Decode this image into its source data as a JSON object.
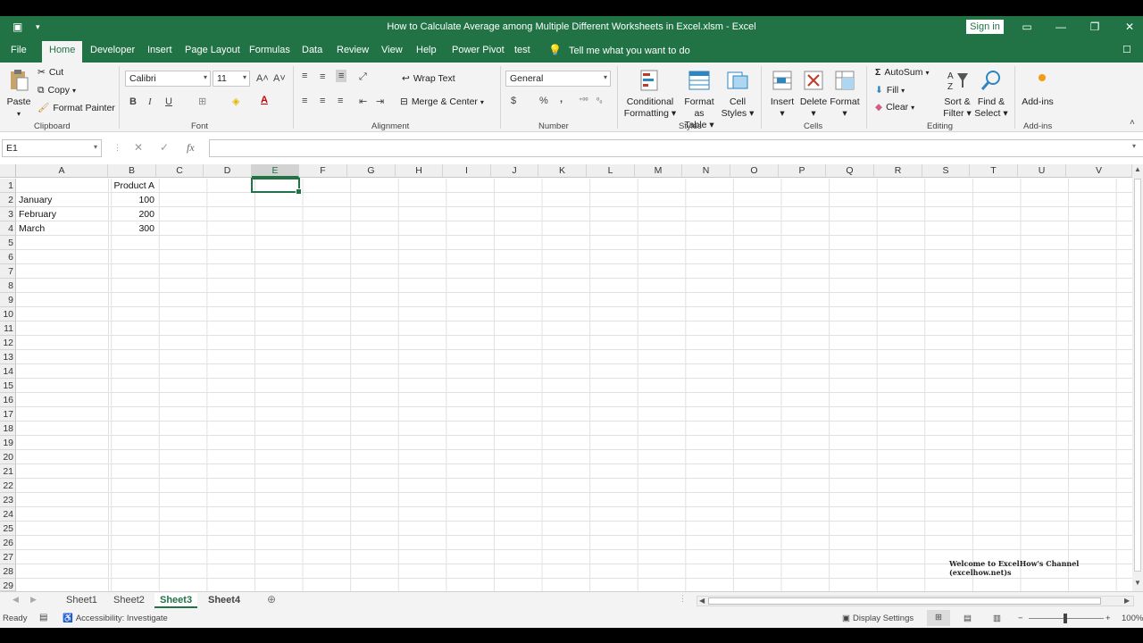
{
  "window": {
    "title": "How to Calculate Average among Multiple Different Worksheets in Excel.xlsm  -  Excel",
    "signin": "Sign in"
  },
  "menu": {
    "tabs": [
      "File",
      "Home",
      "Developer",
      "Insert",
      "Page Layout",
      "Formulas",
      "Data",
      "Review",
      "View",
      "Help",
      "Power Pivot",
      "test"
    ],
    "tell": "Tell me what you want to do"
  },
  "ribbon": {
    "clipboard": {
      "paste": "Paste",
      "cut": "Cut",
      "copy": "Copy",
      "format_painter": "Format Painter",
      "label": "Clipboard"
    },
    "font": {
      "name": "Calibri",
      "size": "11",
      "bold": "B",
      "italic": "I",
      "underline": "U",
      "label": "Font"
    },
    "alignment": {
      "wrap": "Wrap Text",
      "merge": "Merge & Center",
      "label": "Alignment"
    },
    "number": {
      "format": "General",
      "currency": "$",
      "percent": "%",
      "comma": ",",
      "label": "Number"
    },
    "styles": {
      "conditional": [
        "Conditional",
        "Formatting"
      ],
      "format_table": [
        "Format as",
        "Table"
      ],
      "cell_styles": [
        "Cell",
        "Styles"
      ],
      "label": "Styles"
    },
    "cells": {
      "insert": "Insert",
      "delete": "Delete",
      "format": "Format",
      "label": "Cells"
    },
    "editing": {
      "autosum": "AutoSum",
      "fill": "Fill",
      "clear": "Clear",
      "sort": [
        "Sort &",
        "Filter"
      ],
      "find": [
        "Find &",
        "Select"
      ],
      "label": "Editing"
    },
    "addins": {
      "addins": "Add-ins",
      "label": "Add-ins"
    }
  },
  "formula_bar": {
    "name_box": "E1",
    "fx": "fx",
    "value": ""
  },
  "grid": {
    "columns": [
      "A",
      "B",
      "C",
      "D",
      "E",
      "F",
      "G",
      "H",
      "I",
      "J",
      "K",
      "L",
      "M",
      "N",
      "O",
      "P",
      "Q",
      "R",
      "S",
      "T",
      "U",
      "V"
    ],
    "selected_column": "E",
    "rows": [
      "1",
      "2",
      "3",
      "4",
      "5",
      "6",
      "7",
      "8",
      "9",
      "10",
      "11",
      "12",
      "13",
      "14",
      "15",
      "16",
      "17",
      "18",
      "19",
      "20",
      "21",
      "22",
      "23",
      "24",
      "25",
      "26",
      "27",
      "28",
      "29"
    ],
    "data": {
      "B1": "Product A",
      "A2": "January",
      "B2": "100",
      "A3": "February",
      "B3": "200",
      "A4": "March",
      "B4": "300"
    },
    "watermark": "Welcome to ExcelHow's  Channel (excelhow.net)s"
  },
  "sheets": {
    "tabs": [
      "Sheet1",
      "Sheet2",
      "Sheet3",
      "Sheet4"
    ],
    "active": "Sheet3"
  },
  "status": {
    "ready": "Ready",
    "accessibility": "Accessibility: Investigate",
    "display": "Display Settings",
    "zoom": "100%"
  },
  "colors": {
    "excel_green": "#217346",
    "ribbon_bg": "#f3f3f3"
  }
}
